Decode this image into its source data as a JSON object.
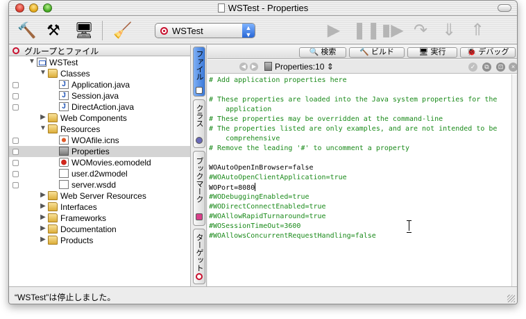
{
  "window": {
    "title": "WSTest - Properties"
  },
  "toolbar": {
    "build_icon": "hammer-icon",
    "clean_icon": "hammer-broom-icon",
    "build_run_icon": "monitor-icon",
    "clean_all_icon": "broom-icon",
    "target": "WSTest",
    "debug_buttons": [
      "play-icon",
      "pause-icon",
      "step-continue-icon",
      "step-over-icon",
      "step-into-icon",
      "step-out-icon"
    ]
  },
  "groups": {
    "header": "グループとファイル",
    "tree": [
      {
        "label": "WSTest",
        "icon": "project",
        "indent": 0,
        "expander": "open",
        "check": false
      },
      {
        "label": "Classes",
        "icon": "folder",
        "indent": 1,
        "expander": "open",
        "check": false
      },
      {
        "label": "Application.java",
        "icon": "java",
        "indent": 2,
        "expander": "",
        "check": true
      },
      {
        "label": "Session.java",
        "icon": "java",
        "indent": 2,
        "expander": "",
        "check": true
      },
      {
        "label": "DirectAction.java",
        "icon": "java",
        "indent": 2,
        "expander": "",
        "check": true
      },
      {
        "label": "Web Components",
        "icon": "folder",
        "indent": 1,
        "expander": "closed",
        "check": false
      },
      {
        "label": "Resources",
        "icon": "folder",
        "indent": 1,
        "expander": "open",
        "check": false
      },
      {
        "label": "WOAfile.icns",
        "icon": "icns",
        "indent": 2,
        "expander": "",
        "check": true
      },
      {
        "label": "Properties",
        "icon": "gray",
        "indent": 2,
        "expander": "",
        "check": true,
        "selected": true
      },
      {
        "label": "WOMovies.eomodeld",
        "icon": "eomodel",
        "indent": 2,
        "expander": "",
        "check": true
      },
      {
        "label": "user.d2wmodel",
        "icon": "plist",
        "indent": 2,
        "expander": "",
        "check": true
      },
      {
        "label": "server.wsdd",
        "icon": "plist",
        "indent": 2,
        "expander": "",
        "check": true
      },
      {
        "label": "Web Server Resources",
        "icon": "folder",
        "indent": 1,
        "expander": "closed",
        "check": false
      },
      {
        "label": "Interfaces",
        "icon": "folder",
        "indent": 1,
        "expander": "closed",
        "check": false
      },
      {
        "label": "Frameworks",
        "icon": "folder",
        "indent": 1,
        "expander": "closed",
        "check": false
      },
      {
        "label": "Documentation",
        "icon": "folder",
        "indent": 1,
        "expander": "closed",
        "check": false
      },
      {
        "label": "Products",
        "icon": "folder",
        "indent": 1,
        "expander": "closed",
        "check": false
      }
    ]
  },
  "side_tabs": [
    "ファイル",
    "クラス",
    "ブックマーク",
    "ターゲット"
  ],
  "editor_tabs": [
    {
      "icon": "🔍",
      "label": "検索"
    },
    {
      "icon": "🔨",
      "label": "ビルド"
    },
    {
      "icon": "🖥",
      "label": "実行"
    },
    {
      "icon": "🐞",
      "label": "デバッグ"
    }
  ],
  "nav": {
    "file": "Properties:10 ⇕"
  },
  "code_lines": [
    {
      "text": "# Add application properties here",
      "type": "comment"
    },
    {
      "text": "",
      "type": "plain"
    },
    {
      "text": "# These properties are loaded into the Java system properties for the",
      "type": "comment"
    },
    {
      "text": "    application",
      "type": "comment"
    },
    {
      "text": "# These properties may be overridden at the command-line",
      "type": "comment"
    },
    {
      "text": "# The properties listed are only examples, and are not intended to be",
      "type": "comment"
    },
    {
      "text": "    comprehensive",
      "type": "comment"
    },
    {
      "text": "# Remove the leading '#' to uncomment a property",
      "type": "comment"
    },
    {
      "text": "",
      "type": "plain"
    },
    {
      "text": "WOAutoOpenInBrowser=false",
      "type": "plain"
    },
    {
      "text": "#WOAutoOpenClientApplication=true",
      "type": "comment"
    },
    {
      "text": "WOPort=8080",
      "type": "plain",
      "caret": true
    },
    {
      "text": "#WODebuggingEnabled=true",
      "type": "comment"
    },
    {
      "text": "#WODirectConnectEnabled=true",
      "type": "comment"
    },
    {
      "text": "#WOAllowRapidTurnaround=true",
      "type": "comment"
    },
    {
      "text": "#WOSessionTimeOut=3600",
      "type": "comment"
    },
    {
      "text": "#WOAllowsConcurrentRequestHandling=false",
      "type": "comment"
    }
  ],
  "status": {
    "text": "“WSTest”は停止しました。"
  }
}
